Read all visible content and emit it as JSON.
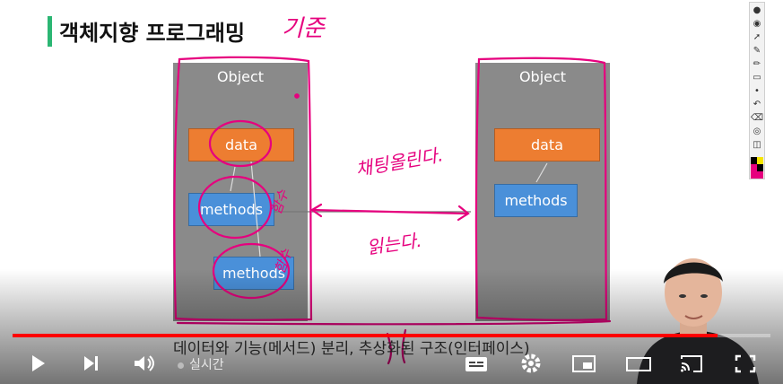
{
  "slide": {
    "title": "객체지향 프로그래밍",
    "left_object": {
      "label": "Object",
      "data_label": "data",
      "methods_1": "methods",
      "methods_2": "methods"
    },
    "right_object": {
      "label": "Object",
      "data_label": "data",
      "methods": "methods"
    },
    "subtitle": "데이터와 기능(메서드) 분리, 추상화된 구조(인터페이스)",
    "colors": {
      "accent": "#2bb673",
      "orange": "#ed7d31",
      "blue": "#4a90d9",
      "ink": "#e6007e"
    }
  },
  "annotations": {
    "top": "기준",
    "arrow_upper": "채팅올린다.",
    "arrow_lower": "읽는다.",
    "side_1": "함수",
    "side_2": "함수"
  },
  "player": {
    "progress_fraction": 0.93,
    "live_label": "실시간",
    "controls": [
      "play-icon",
      "next-icon",
      "volume-icon",
      "subtitles-icon",
      "settings-icon",
      "miniplayer-icon",
      "theater-icon",
      "cast-icon",
      "fullscreen-icon"
    ]
  },
  "toolbar": {
    "icons": [
      "pin-icon",
      "eye-icon",
      "cursor-icon",
      "pen-icon",
      "highlighter-icon",
      "eraser-icon",
      "dot-icon",
      "undo-icon",
      "trash-icon",
      "camera-icon",
      "copy-icon"
    ],
    "colors": [
      "#000000",
      "#f6e600",
      "#e6007e",
      "#000000",
      "#e6007e",
      "#e6007e"
    ]
  }
}
